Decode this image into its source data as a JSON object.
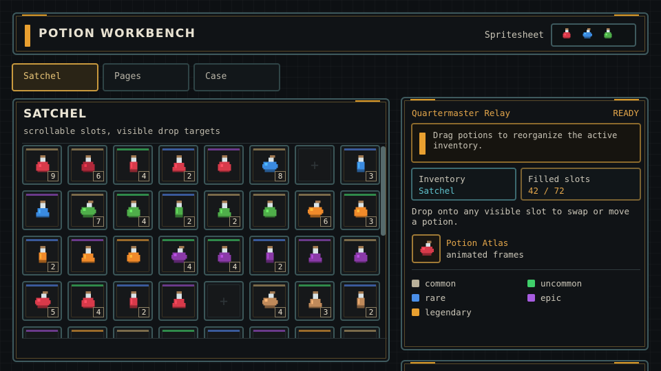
{
  "header": {
    "title": "POTION WORKBENCH",
    "spritesheet_label": "Spritesheet",
    "spritesheet_icons": [
      "red-potion-icon",
      "blue-potion-icon",
      "green-potion-icon"
    ]
  },
  "tabs": [
    {
      "label": "Satchel",
      "active": true
    },
    {
      "label": "Pages",
      "active": false
    },
    {
      "label": "Case",
      "active": false
    }
  ],
  "satchel": {
    "title": "SATCHEL",
    "subtitle": "scrollable slots, visible drop targets",
    "slots": [
      {
        "potion": "red",
        "shape": "round",
        "count": "9",
        "rarity": "common"
      },
      {
        "potion": "crimson",
        "shape": "round",
        "count": "6",
        "rarity": "common"
      },
      {
        "potion": "red",
        "shape": "vial",
        "count": "4",
        "rarity": "uncommon"
      },
      {
        "potion": "red",
        "shape": "flask",
        "count": "2",
        "rarity": "rare"
      },
      {
        "potion": "red",
        "shape": "round",
        "count": "",
        "rarity": "epic"
      },
      {
        "potion": "blue",
        "shape": "tilted",
        "count": "8",
        "rarity": "common"
      },
      {
        "potion": "",
        "shape": "",
        "count": "",
        "rarity": ""
      },
      {
        "potion": "blue",
        "shape": "vial",
        "count": "3",
        "rarity": "rare"
      },
      {
        "potion": "blue",
        "shape": "flask",
        "count": "",
        "rarity": "epic"
      },
      {
        "potion": "green",
        "shape": "tilted",
        "count": "7",
        "rarity": "common"
      },
      {
        "potion": "green",
        "shape": "round",
        "count": "4",
        "rarity": "uncommon"
      },
      {
        "potion": "green",
        "shape": "vial",
        "count": "2",
        "rarity": "rare"
      },
      {
        "potion": "green",
        "shape": "flask",
        "count": "2",
        "rarity": "common"
      },
      {
        "potion": "green",
        "shape": "round",
        "count": "",
        "rarity": "common"
      },
      {
        "potion": "orange",
        "shape": "tilted",
        "count": "6",
        "rarity": "common"
      },
      {
        "potion": "orange",
        "shape": "round",
        "count": "3",
        "rarity": "uncommon"
      },
      {
        "potion": "orange",
        "shape": "vial",
        "count": "2",
        "rarity": "rare"
      },
      {
        "potion": "orange",
        "shape": "flask",
        "count": "",
        "rarity": "epic"
      },
      {
        "potion": "orange",
        "shape": "round",
        "count": "",
        "rarity": "legendary"
      },
      {
        "potion": "purple",
        "shape": "tilted",
        "count": "4",
        "rarity": "uncommon"
      },
      {
        "potion": "purple",
        "shape": "round",
        "count": "4",
        "rarity": "uncommon"
      },
      {
        "potion": "purple",
        "shape": "vial",
        "count": "2",
        "rarity": "rare"
      },
      {
        "potion": "purple",
        "shape": "flask",
        "count": "",
        "rarity": "epic"
      },
      {
        "potion": "purple",
        "shape": "round",
        "count": "",
        "rarity": "common"
      },
      {
        "potion": "red",
        "shape": "tilted",
        "count": "5",
        "rarity": "rare"
      },
      {
        "potion": "red",
        "shape": "round",
        "count": "4",
        "rarity": "uncommon"
      },
      {
        "potion": "red",
        "shape": "vial",
        "count": "2",
        "rarity": "rare"
      },
      {
        "potion": "red",
        "shape": "flask",
        "count": "",
        "rarity": "epic"
      },
      {
        "potion": "",
        "shape": "",
        "count": "",
        "rarity": ""
      },
      {
        "potion": "tan",
        "shape": "tilted",
        "count": "4",
        "rarity": "common"
      },
      {
        "potion": "tan",
        "shape": "flask",
        "count": "3",
        "rarity": "uncommon"
      },
      {
        "potion": "tan",
        "shape": "vial",
        "count": "2",
        "rarity": "rare"
      },
      {
        "potion": "",
        "shape": "",
        "count": "",
        "rarity": "epic"
      },
      {
        "potion": "",
        "shape": "",
        "count": "",
        "rarity": "legendary"
      },
      {
        "potion": "",
        "shape": "",
        "count": "",
        "rarity": "common"
      },
      {
        "potion": "",
        "shape": "",
        "count": "",
        "rarity": "uncommon"
      },
      {
        "potion": "",
        "shape": "",
        "count": "",
        "rarity": "rare"
      },
      {
        "potion": "",
        "shape": "",
        "count": "",
        "rarity": "epic"
      },
      {
        "potion": "",
        "shape": "",
        "count": "",
        "rarity": "legendary"
      },
      {
        "potion": "",
        "shape": "",
        "count": "",
        "rarity": "common"
      }
    ]
  },
  "relay": {
    "title": "Quartermaster Relay",
    "status": "READY",
    "notice": "Drag potions to reorganize the active inventory.",
    "inventory_label": "Inventory",
    "inventory_value": "Satchel",
    "filled_label": "Filled slots",
    "filled_value": "42 / 72",
    "hint": "Drop onto any visible slot to swap or move a potion.",
    "atlas_title": "Potion Atlas",
    "atlas_sub": "animated frames",
    "legend": [
      {
        "label": "common",
        "color": "#b9b09a"
      },
      {
        "label": "uncommon",
        "color": "#3fcf6a"
      },
      {
        "label": "rare",
        "color": "#4a8fe8"
      },
      {
        "label": "epic",
        "color": "#a75ce0"
      },
      {
        "label": "legendary",
        "color": "#e9a030"
      }
    ]
  },
  "colors": {
    "red": "#d83a4a",
    "crimson": "#b0283a",
    "blue": "#3a8ae0",
    "green": "#4fae4a",
    "orange": "#f08a2a",
    "purple": "#8a3aa8",
    "tan": "#c08a5a",
    "rarity": {
      "common": "#7a6a4a",
      "uncommon": "#2f8a4a",
      "rare": "#3a5a9a",
      "epic": "#6a3a8a",
      "legendary": "#9a6a2a"
    }
  }
}
